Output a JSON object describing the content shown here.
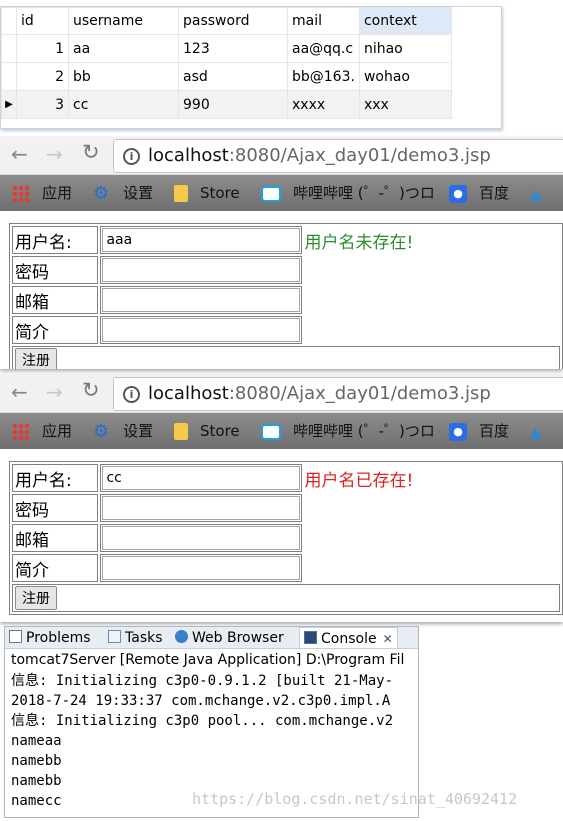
{
  "db_table": {
    "columns": [
      "id",
      "username",
      "password",
      "mail",
      "context"
    ],
    "rows": [
      {
        "id": "1",
        "username": "aa",
        "password": "123",
        "mail": "aa@qq.c",
        "context": "nihao"
      },
      {
        "id": "2",
        "username": "bb",
        "password": "asd",
        "mail": "bb@163.",
        "context": "wohao"
      },
      {
        "id": "3",
        "username": "cc",
        "password": "990",
        "mail": "xxxx",
        "context": "xxx"
      }
    ],
    "current_row_marker": "▶"
  },
  "browser": {
    "url_host": "localhost",
    "url_rest": ":8080/Ajax_day01/demo3.jsp",
    "bookmarks": {
      "apps": "应用",
      "settings": "设置",
      "store": "Store",
      "bilibili": "哔哩哔哩 (゜-゜)つロ",
      "baidu": "百度"
    }
  },
  "form_labels": {
    "username": "用户名:",
    "password": "密码",
    "email": "邮箱",
    "intro": "简介",
    "register": "注册"
  },
  "form1": {
    "username_value": "aaa",
    "message": "用户名未存在!"
  },
  "form2": {
    "username_value": "cc",
    "message": "用户名已存在!"
  },
  "console": {
    "tabs": {
      "problems": "Problems",
      "tasks": "Tasks",
      "web_browser": "Web Browser",
      "console": "Console"
    },
    "header": "tomcat7Server [Remote Java Application] D:\\Program Fil",
    "lines": [
      "信息: Initializing c3p0-0.9.1.2 [built 21-May-",
      "2018-7-24 19:33:37 com.mchange.v2.c3p0.impl.A",
      "信息: Initializing c3p0 pool... com.mchange.v2",
      "nameaa",
      "namebb",
      "namebb",
      "namecc"
    ]
  },
  "watermark": "https://blog.csdn.net/sinat_40692412"
}
